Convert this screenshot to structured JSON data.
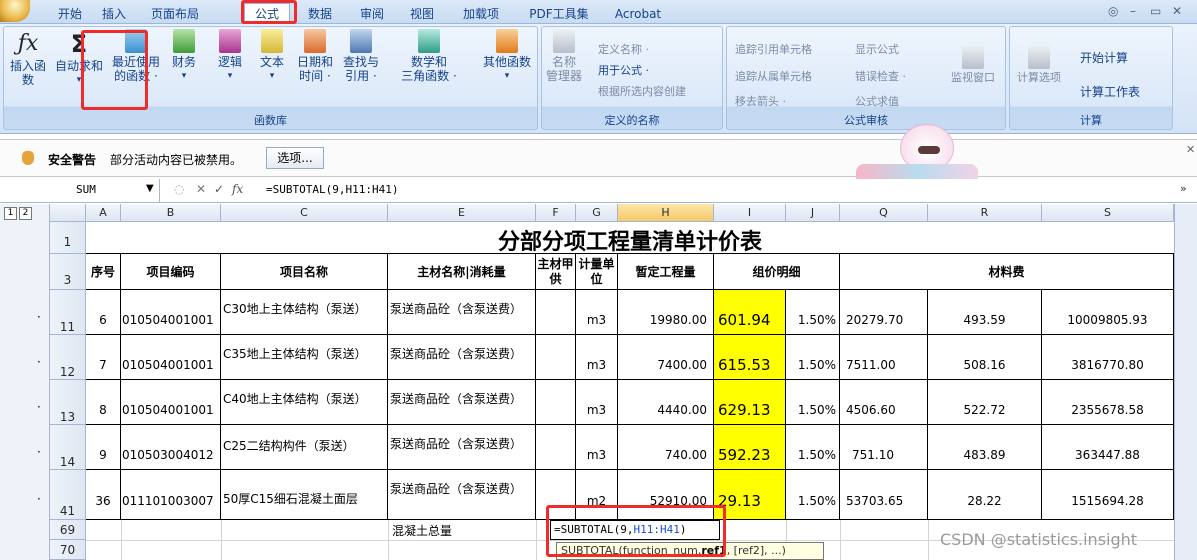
{
  "tabs": [
    "开始",
    "插入",
    "页面布局",
    "公式",
    "数据",
    "审阅",
    "视图",
    "加载项",
    "PDF工具集",
    "Acrobat"
  ],
  "active_tab": "公式",
  "window_controls": [
    "◎",
    "–",
    "▭",
    "✕"
  ],
  "ribbon": {
    "fn_library": {
      "label": "函数库",
      "insert_fn": "插入函数",
      "autosum": "自动求和",
      "recent": [
        "最近使用",
        "的函数 ·"
      ],
      "finance": "财务",
      "logic": "逻辑",
      "text": "文本",
      "datetime": [
        "日期和",
        "时间 ·"
      ],
      "lookup": [
        "查找与",
        "引用 ·"
      ],
      "math": [
        "数学和",
        "三角函数 ·"
      ],
      "other": "其他函数"
    },
    "defined_names": {
      "label": "定义的名称",
      "name_mgr": [
        "名称",
        "管理器"
      ],
      "define_name": "定义名称 ·",
      "use_in_formula": "用于公式 ·",
      "create_from_sel": "根据所选内容创建"
    },
    "auditing": {
      "label": "公式审核",
      "trace_prec": "追踪引用单元格",
      "trace_dep": "追踪从属单元格",
      "remove_arrows": "移去箭头 ·",
      "show_formulas": "显示公式",
      "error_check": "错误检查 ·",
      "evaluate": "公式求值",
      "watch": "监视窗口"
    },
    "calculation": {
      "label": "计算",
      "options": "计算选项",
      "calc_now": "开始计算",
      "calc_sheet": "计算工作表"
    }
  },
  "security": {
    "title": "安全警告",
    "message": "部分活动内容已被禁用。",
    "button": "选项..."
  },
  "formula_bar": {
    "name_box": "SUM",
    "fx": "fx",
    "formula": "=SUBTOTAL(9,H11:H41)"
  },
  "outline_levels": [
    "1",
    "2"
  ],
  "columns": [
    "A",
    "B",
    "C",
    "E",
    "F",
    "G",
    "H",
    "I",
    "J",
    "Q",
    "R",
    "S"
  ],
  "sheet": {
    "title": "分部分项工程量清单计价表",
    "headers": {
      "seq": "序号",
      "code": "项目编码",
      "name": "项目名称",
      "material": "主材名称|消耗量",
      "main_supply": "主材甲供",
      "unit": "计量单位",
      "qty": "暂定工程量",
      "price_detail": "组价明细",
      "material_fee": "材料费"
    },
    "rows": [
      {
        "row": "11",
        "seq": "6",
        "code": "010504001001",
        "name": "C30地上主体结构（泵送）",
        "material": "泵送商品砼（含泵送费）",
        "unit": "m3",
        "qty": "19980.00",
        "price": "601.94",
        "rate": "1.50%",
        "q": "20279.70",
        "r": "493.59",
        "s": "10009805.93"
      },
      {
        "row": "12",
        "seq": "7",
        "code": "010504001001",
        "name": "C35地上主体结构（泵送）",
        "material": "泵送商品砼（含泵送费）",
        "unit": "m3",
        "qty": "7400.00",
        "price": "615.53",
        "rate": "1.50%",
        "q": "7511.00",
        "r": "508.16",
        "s": "3816770.80"
      },
      {
        "row": "13",
        "seq": "8",
        "code": "010504001001",
        "name": "C40地上主体结构（泵送）",
        "material": "泵送商品砼（含泵送费）",
        "unit": "m3",
        "qty": "4440.00",
        "price": "629.13",
        "rate": "1.50%",
        "q": "4506.60",
        "r": "522.72",
        "s": "2355678.58"
      },
      {
        "row": "14",
        "seq": "9",
        "code": "010503004012",
        "name": "C25二结构构件（泵送）",
        "material": "泵送商品砼（含泵送费）",
        "unit": "m3",
        "qty": "740.00",
        "price": "592.23",
        "rate": "1.50%",
        "q": "751.10",
        "r": "483.89",
        "s": "363447.88"
      },
      {
        "row": "41",
        "seq": "36",
        "code": "011101003007",
        "name": "50厚C15细石混凝土面层",
        "material": "泵送商品砼（含泵送费）",
        "unit": "m2",
        "qty": "52910.00",
        "price": "29.13",
        "rate": "1.50%",
        "q": "53703.65",
        "r": "28.22",
        "s": "1515694.28"
      }
    ],
    "row69_label": "混凝土总量",
    "editing_formula_prefix": "=SUBTOTAL(9,",
    "editing_formula_ref": "H11:H41",
    "editing_formula_suffix": ")",
    "tooltip_prefix": "SUBTOTAL(function_num,",
    "tooltip_bold": "ref1",
    "tooltip_suffix": ", [ref2], ...)",
    "row_numbers_extra": [
      "1",
      "3",
      "69",
      "70"
    ]
  },
  "watermark": "CSDN @statistics.insight",
  "colors": {
    "highlight": "#ffff00",
    "callout": "#ef2b2b",
    "accent": "#15428b"
  }
}
